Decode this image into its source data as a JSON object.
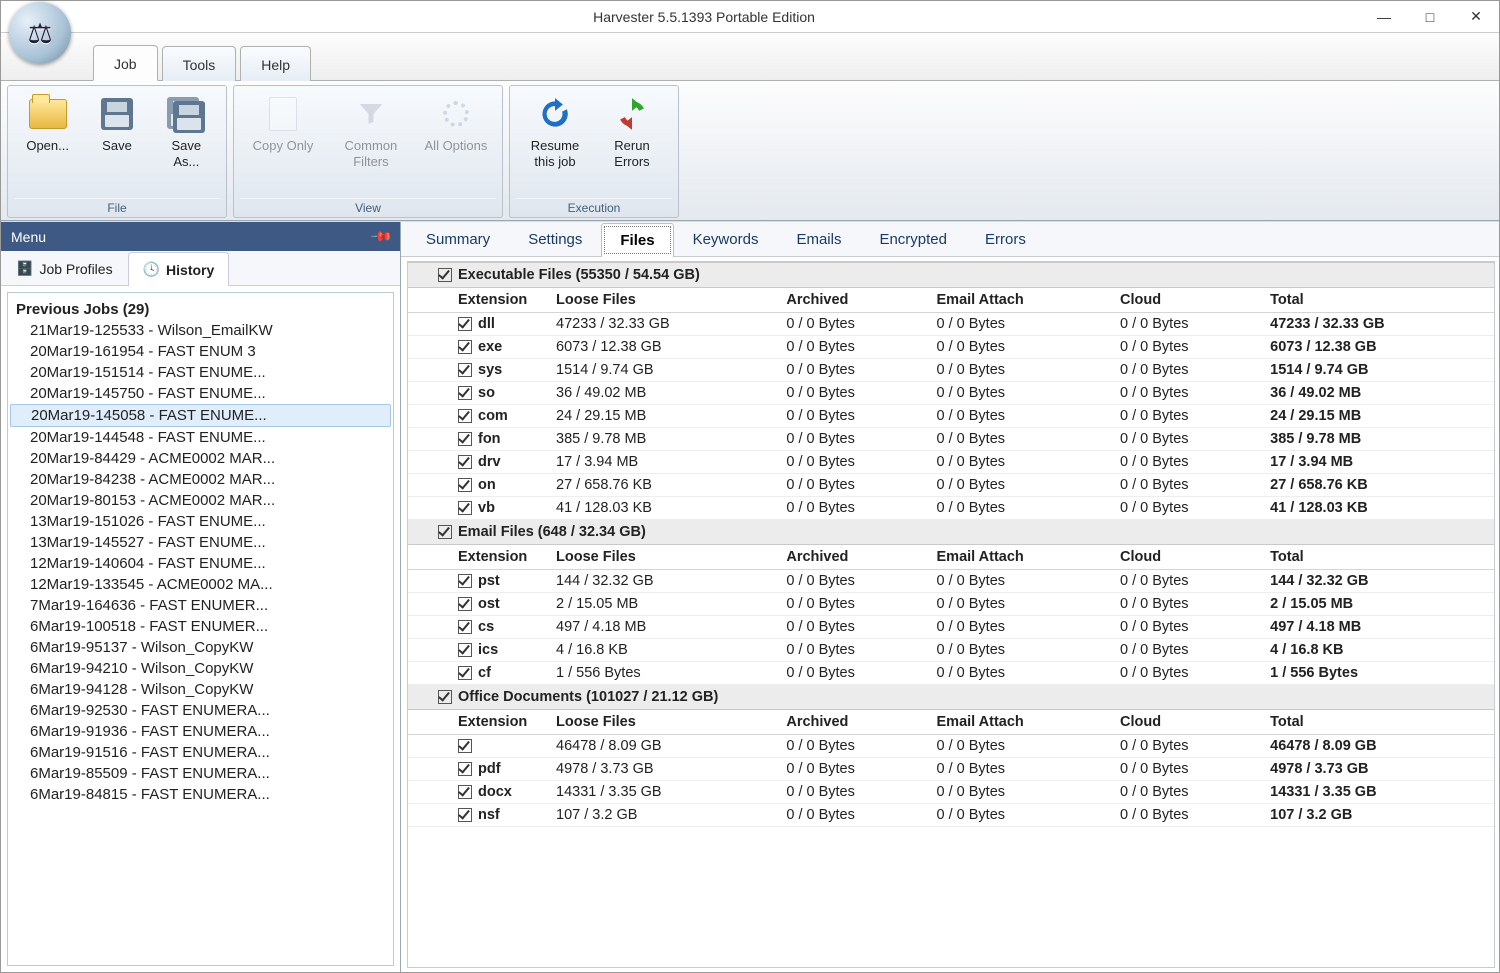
{
  "window": {
    "title": "Harvester 5.5.1393 Portable Edition"
  },
  "menus": {
    "job": "Job",
    "tools": "Tools",
    "help": "Help"
  },
  "ribbon": {
    "file": {
      "label": "File",
      "open": "Open...",
      "save": "Save",
      "save_as": "Save As..."
    },
    "view": {
      "label": "View",
      "copy_only": "Copy Only",
      "common_filters": "Common Filters",
      "all_options": "All Options"
    },
    "execution": {
      "label": "Execution",
      "resume": "Resume this job",
      "rerun": "Rerun Errors"
    }
  },
  "left": {
    "menu_header": "Menu",
    "tabs": {
      "profiles": "Job Profiles",
      "history": "History"
    },
    "history_root": "Previous Jobs (29)",
    "history_items": [
      "21Mar19-125533 - Wilson_EmailKW",
      "20Mar19-161954 - FAST ENUM 3",
      "20Mar19-151514 - FAST ENUME...",
      "20Mar19-145750 - FAST ENUME...",
      "20Mar19-145058 - FAST ENUME...",
      "20Mar19-144548 - FAST ENUME...",
      "20Mar19-84429 - ACME0002 MAR...",
      "20Mar19-84238 - ACME0002 MAR...",
      "20Mar19-80153 - ACME0002 MAR...",
      "13Mar19-151026 - FAST ENUME...",
      "13Mar19-145527 - FAST ENUME...",
      "12Mar19-140604 - FAST ENUME...",
      "12Mar19-133545 - ACME0002 MA...",
      "7Mar19-164636 - FAST ENUMER...",
      "6Mar19-100518 - FAST ENUMER...",
      "6Mar19-95137 - Wilson_CopyKW",
      "6Mar19-94210 - Wilson_CopyKW",
      "6Mar19-94128 - Wilson_CopyKW",
      "6Mar19-92530 - FAST ENUMERA...",
      "6Mar19-91936 - FAST ENUMERA...",
      "6Mar19-91516 - FAST ENUMERA...",
      "6Mar19-85509 - FAST ENUMERA...",
      "6Mar19-84815 - FAST ENUMERA..."
    ],
    "selected_index": 4
  },
  "view_tabs": [
    "Summary",
    "Settings",
    "Files",
    "Keywords",
    "Emails",
    "Encrypted",
    "Errors"
  ],
  "view_tab_active": 2,
  "columns": {
    "ext": "Extension",
    "loose": "Loose Files",
    "arch": "Archived",
    "email": "Email Attach",
    "cloud": "Cloud",
    "total": "Total"
  },
  "zero": "0 / 0 Bytes",
  "groups": [
    {
      "title": "Executable Files (55350 / 54.54 GB)",
      "rows": [
        {
          "ext": "dll",
          "loose": "47233 / 32.33 GB",
          "total": "47233 / 32.33 GB"
        },
        {
          "ext": "exe",
          "loose": "6073 / 12.38 GB",
          "total": "6073 / 12.38 GB"
        },
        {
          "ext": "sys",
          "loose": "1514 / 9.74 GB",
          "total": "1514 / 9.74 GB"
        },
        {
          "ext": "so",
          "loose": "36 / 49.02 MB",
          "total": "36 / 49.02 MB"
        },
        {
          "ext": "com",
          "loose": "24 / 29.15 MB",
          "total": "24 / 29.15 MB"
        },
        {
          "ext": "fon",
          "loose": "385 / 9.78 MB",
          "total": "385 / 9.78 MB"
        },
        {
          "ext": "drv",
          "loose": "17 / 3.94 MB",
          "total": "17 / 3.94 MB"
        },
        {
          "ext": "on",
          "loose": "27 / 658.76 KB",
          "total": "27 / 658.76 KB"
        },
        {
          "ext": "vb",
          "loose": "41 / 128.03 KB",
          "total": "41 / 128.03 KB"
        }
      ]
    },
    {
      "title": "Email Files (648 / 32.34 GB)",
      "rows": [
        {
          "ext": "pst",
          "loose": "144 / 32.32 GB",
          "total": "144 / 32.32 GB"
        },
        {
          "ext": "ost",
          "loose": "2 / 15.05 MB",
          "total": "2 / 15.05 MB"
        },
        {
          "ext": "cs",
          "loose": "497 / 4.18 MB",
          "total": "497 / 4.18 MB"
        },
        {
          "ext": "ics",
          "loose": "4 / 16.8 KB",
          "total": "4 / 16.8 KB"
        },
        {
          "ext": "cf",
          "loose": "1 / 556 Bytes",
          "total": "1 / 556 Bytes"
        }
      ]
    },
    {
      "title": "Office Documents (101027 / 21.12 GB)",
      "rows": [
        {
          "ext": "",
          "loose": "46478 / 8.09 GB",
          "total": "46478 / 8.09 GB"
        },
        {
          "ext": "pdf",
          "loose": "4978 / 3.73 GB",
          "total": "4978 / 3.73 GB"
        },
        {
          "ext": "docx",
          "loose": "14331 / 3.35 GB",
          "total": "14331 / 3.35 GB"
        },
        {
          "ext": "nsf",
          "loose": "107 / 3.2 GB",
          "total": "107 / 3.2 GB"
        }
      ]
    }
  ]
}
